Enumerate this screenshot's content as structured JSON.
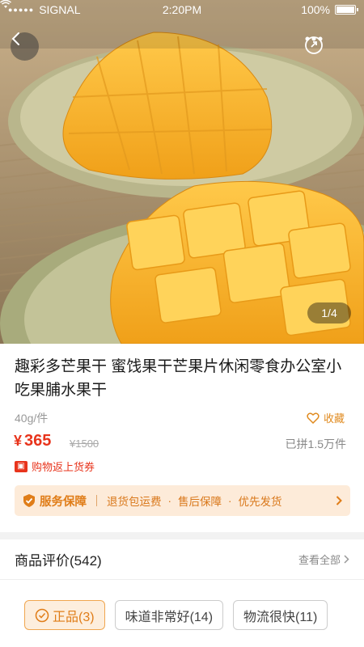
{
  "status_bar": {
    "carrier": "SIGNAL",
    "time": "2:20PM",
    "battery": "100%"
  },
  "gallery": {
    "pager": "1/4",
    "image_desc_icon": "mango-photo"
  },
  "product": {
    "title": "趣彩多芒果干 蜜饯果干芒果片休闲零食办公室小吃果脯水果干",
    "unit": "40g/件",
    "favorite_label": "收藏",
    "price_symbol": "¥",
    "price": "365",
    "original_price": "¥1500",
    "sold": "已拼1.5万件",
    "cashback": "购物返上货券"
  },
  "service": {
    "title": "服务保障",
    "items": [
      "退货包运费",
      "售后保障",
      "优先发货"
    ]
  },
  "reviews": {
    "title": "商品评价(542)",
    "view_all": "查看全部",
    "tags": [
      {
        "label": "正品(3)"
      },
      {
        "label": "味道非常好(14)"
      },
      {
        "label": "物流很快(11)"
      }
    ]
  },
  "colors": {
    "price_red": "#e8341c",
    "accent_orange": "#e07d18",
    "service_bg": "#fdebd9"
  }
}
